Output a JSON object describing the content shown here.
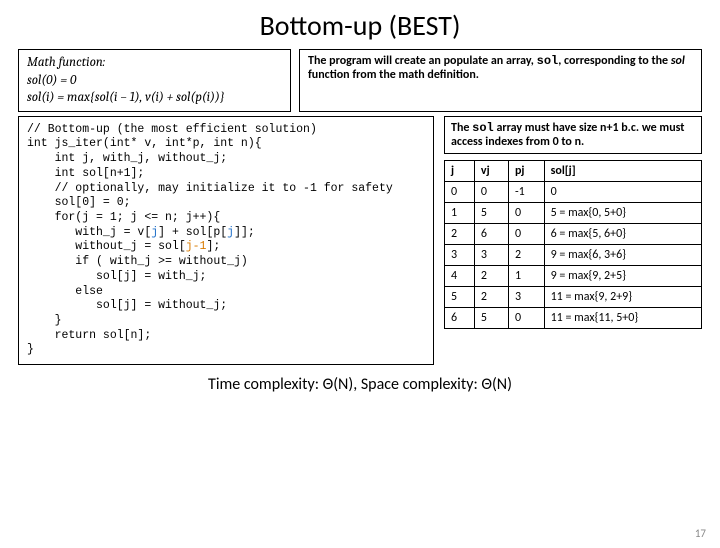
{
  "title": "Bottom-up (BEST)",
  "math": {
    "label": "Math function:",
    "l1": "sol(0) = 0",
    "l2": "sol(i) = max{sol(i − 1), v(i) + sol(p(i))}"
  },
  "desc": {
    "t1": "The program will create an populate an array, ",
    "code": "sol",
    "t2": ", corresponding to the ",
    "it": "sol",
    "t3": " function from the math definition."
  },
  "code": {
    "l0": "// Bottom-up (the most efficient solution)",
    "l1": "int js_iter(int* v, int*p, int n){",
    "l2": "    int j, with_j, without_j;",
    "l3": "    int sol[n+1];",
    "l4": "    // optionally, may initialize it to -1 for safety",
    "l5": "    sol[0] = 0;",
    "l6": "    for(j = 1; j <= n; j++){",
    "l7a": "       with_j = v[",
    "l7b": "j",
    "l7c": "] + sol[p[",
    "l7d": "j",
    "l7e": "]];",
    "l8a": "       without_j = sol[",
    "l8b": "j-1",
    "l8c": "];",
    "l9": "       if ( with_j >= without_j)",
    "l10": "          sol[j] = with_j;",
    "l11": "       else",
    "l12": "          sol[j] = without_j;",
    "l13": "    }",
    "l14": "    return sol[n];",
    "l15": "}"
  },
  "note": {
    "t1": "The ",
    "code": "sol",
    "t2": " array must have size n+1 b.c. we must access indexes from 0 to n."
  },
  "tbl": {
    "h": [
      "j",
      "vj",
      "pj",
      "sol[j]"
    ],
    "r": [
      [
        "0",
        "0",
        "-1",
        "0"
      ],
      [
        "1",
        "5",
        "0",
        "5 = max{0, 5+0}"
      ],
      [
        "2",
        "6",
        "0",
        "6 = max{5, 6+0}"
      ],
      [
        "3",
        "3",
        "2",
        "9 = max{6, 3+6}"
      ],
      [
        "4",
        "2",
        "1",
        "9 = max{9, 2+5}"
      ],
      [
        "5",
        "2",
        "3",
        "11 = max{9, 2+9}"
      ],
      [
        "6",
        "5",
        "0",
        "11 = max{11, 5+0}"
      ]
    ]
  },
  "complex": "Time complexity: Θ(N), Space complexity: Θ(N)",
  "page": "17"
}
